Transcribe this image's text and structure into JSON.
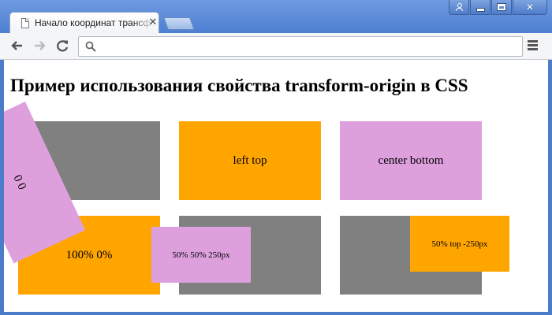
{
  "browser": {
    "tab": {
      "title": "Начало координат трансформации"
    },
    "address_bar": {
      "value": "",
      "placeholder": ""
    }
  },
  "page": {
    "heading": "Пример использования свойства transform-origin в CSS",
    "demos": [
      {
        "label": "0 0",
        "rotate_deg": 65,
        "color": "#dda0dd"
      },
      {
        "label": "left top",
        "color": "#ffa500"
      },
      {
        "label": "center bottom",
        "color": "#dda0dd"
      },
      {
        "label": "100% 0%",
        "color": "#ffa500"
      },
      {
        "label": "50% 50% 250px",
        "color": "#dda0dd"
      },
      {
        "label": "50% top -250px",
        "color": "#ffa500"
      }
    ],
    "background_color": "#808080"
  }
}
